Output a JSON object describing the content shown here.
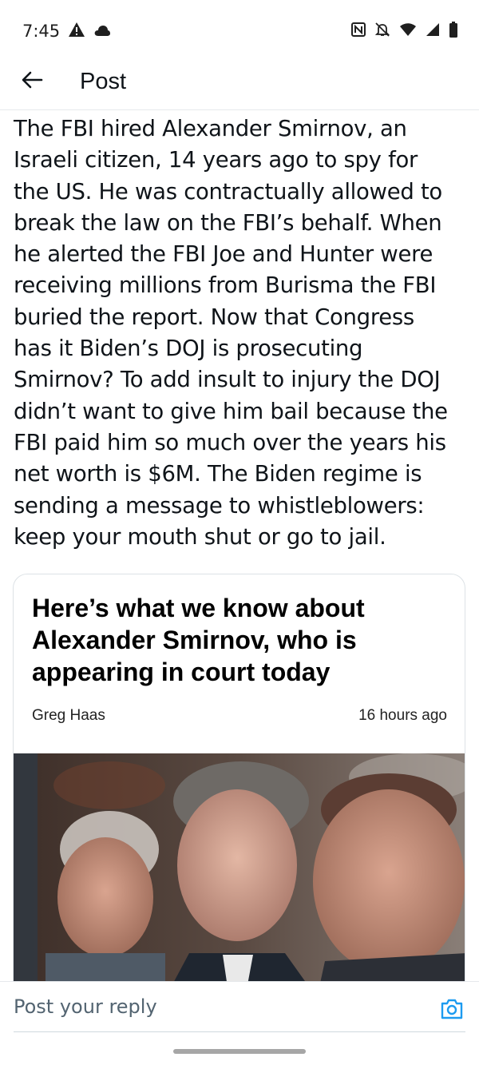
{
  "status_bar": {
    "time": "7:45",
    "left_icons": [
      "alert-triangle-icon",
      "cloud-icon"
    ],
    "right_icons": [
      "nfc-icon",
      "bell-off-icon",
      "wifi-icon",
      "signal-icon",
      "battery-icon"
    ]
  },
  "header": {
    "title": "Post",
    "back_icon": "arrow-left-icon"
  },
  "post": {
    "text": "The FBI hired Alexander Smirnov, an\nIsraeli citizen, 14 years ago to spy for\nthe US. He was contractually allowed to\nbreak the law on the FBI’s behalf. When\nhe alerted the FBI Joe and Hunter were\nreceiving millions from Burisma the FBI\nburied the report. Now that Congress\nhas it Biden’s DOJ is prosecuting\nSmirnov? To add insult to injury the DOJ\ndidn’t want to give him bail because the\nFBI paid him so much over the years his\nnet worth is $6M. The Biden regime is\nsending a message to whistleblowers:\nkeep your mouth shut or go to jail."
  },
  "card": {
    "headline": "Here’s what we know about\nAlexander Smirnov, who is\nappearing in court today",
    "author": "Greg Haas",
    "time": "16 hours ago"
  },
  "reply": {
    "placeholder": "Post your reply",
    "camera_icon": "camera-icon"
  },
  "colors": {
    "text": "#0f1419",
    "muted": "#536471",
    "accent": "#1d9bf0",
    "border": "#dde2e6"
  }
}
